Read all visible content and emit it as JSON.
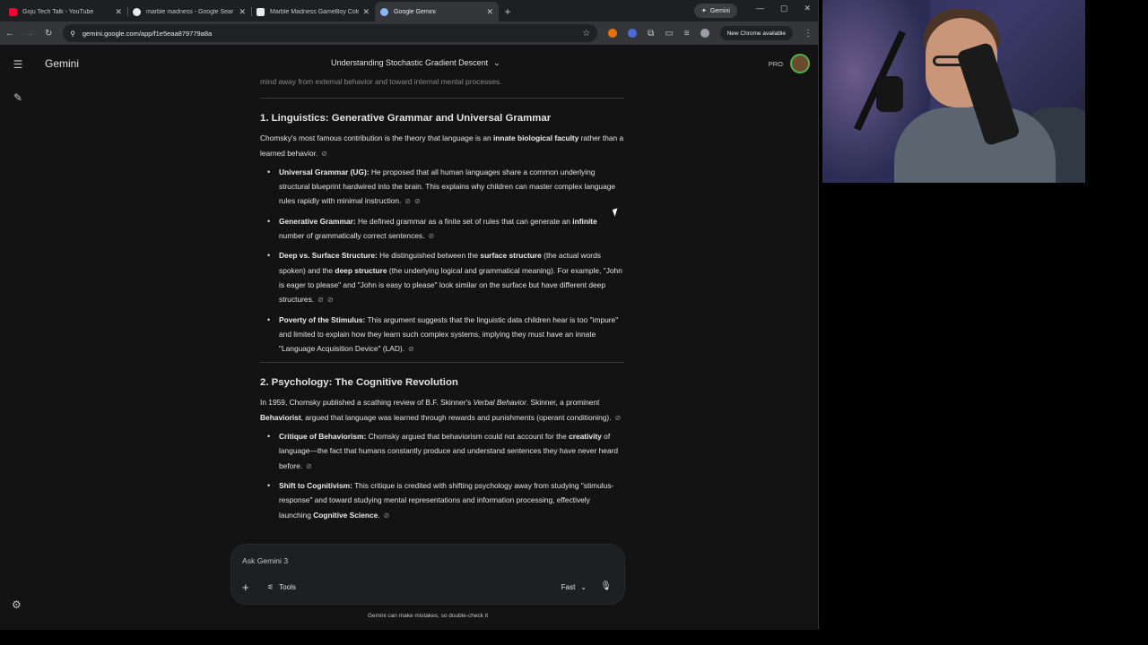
{
  "browser": {
    "tabs": [
      {
        "title": "Goju Tech Talk - YouTube",
        "favicon_color": "#ff0033",
        "active": false
      },
      {
        "title": "marble madness - Google Sear",
        "favicon_color": "#e8eaed",
        "active": false
      },
      {
        "title": "Marble Madness GameBoy Colo",
        "favicon_color": "#e8eaed",
        "active": false
      },
      {
        "title": "Google Gemini",
        "favicon_color": "#8ab4f8",
        "active": true
      }
    ],
    "gemini_chip": "Gemini",
    "url": "gemini.google.com/app/f1e5eaa879779a8a",
    "chrome_available": "New Chrome available"
  },
  "app": {
    "brand": "Gemini",
    "conversation_title": "Understanding Stochastic Gradient Descent",
    "plan_badge": "PRO",
    "cut_off_line": "mind away from external behavior and toward internal mental processes.",
    "section1": {
      "heading": "1. Linguistics: Generative Grammar and Universal Grammar",
      "intro_pre": "Chomsky's most famous contribution is the theory that language is an ",
      "intro_bold": "innate biological faculty",
      "intro_post": " rather than a learned behavior.",
      "items": [
        {
          "term": "Universal Grammar (UG):",
          "text": " He proposed that all human languages share a common underlying structural blueprint hardwired into the brain. This explains why children can master complex language rules rapidly with minimal instruction."
        },
        {
          "term": "Generative Grammar:",
          "text_pre": " He defined grammar as a finite set of rules that can generate an ",
          "bold": "infinite",
          "text_post": " number of grammatically correct sentences."
        },
        {
          "term": "Deep vs. Surface Structure:",
          "text_a": " He distinguished between the ",
          "bold_a": "surface structure",
          "text_b": " (the actual words spoken) and the ",
          "bold_b": "deep structure",
          "text_c": " (the underlying logical and grammatical meaning). For example, \"John is eager to please\" and \"John is easy to please\" look similar on the surface but have different deep structures."
        },
        {
          "term": "Poverty of the Stimulus:",
          "text": " This argument suggests that the linguistic data children hear is too \"impure\" and limited to explain how they learn such complex systems, implying they must have an innate \"Language Acquisition Device\" (LAD)."
        }
      ]
    },
    "section2": {
      "heading": "2. Psychology: The Cognitive Revolution",
      "intro_a": "In 1959, Chomsky published a scathing review of B.F. Skinner's ",
      "intro_italic": "Verbal Behavior",
      "intro_b": ". Skinner, a prominent ",
      "intro_bold": "Behaviorist",
      "intro_c": ", argued that language was learned through rewards and punishments (operant conditioning).",
      "items": [
        {
          "term": "Critique of Behaviorism:",
          "text_pre": " Chomsky argued that behaviorism could not account for the ",
          "bold": "creativity",
          "text_post": " of language—the fact that humans constantly produce and understand sentences they have never heard before."
        },
        {
          "term": "Shift to Cognitivism:",
          "text_pre": " This critique is credited with shifting psychology away from studying \"stimulus-response\" and toward studying mental representations and information processing, effectively launching ",
          "bold": "Cognitive Science",
          "text_post": "."
        }
      ]
    },
    "input": {
      "placeholder": "Ask Gemini 3",
      "tools_label": "Tools",
      "mode_label": "Fast"
    },
    "disclaimer": "Gemini can make mistakes, so double-check it"
  }
}
